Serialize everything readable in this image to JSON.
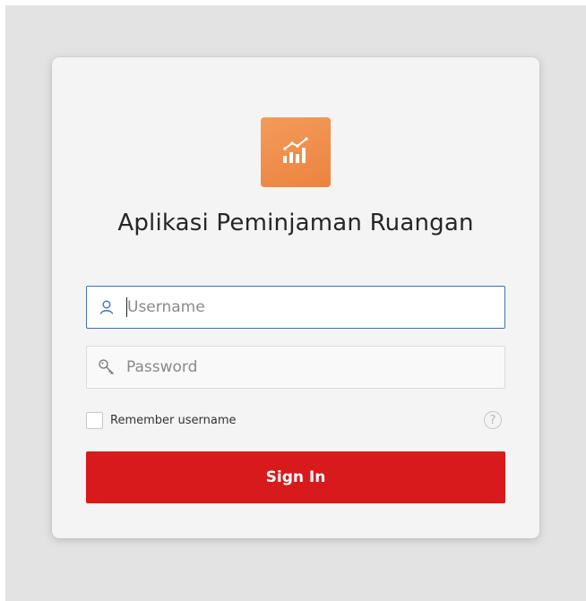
{
  "app": {
    "title": "Aplikasi Peminjaman Ruangan",
    "logo_icon": "chart-bars-icon"
  },
  "form": {
    "username": {
      "value": "",
      "placeholder": "Username",
      "icon": "user-icon"
    },
    "password": {
      "value": "",
      "placeholder": "Password",
      "icon": "key-icon"
    },
    "remember": {
      "label": "Remember username",
      "checked": false
    },
    "help_glyph": "?",
    "submit_label": "Sign In"
  },
  "colors": {
    "background": "#e3e3e3",
    "card": "#f4f4f4",
    "logo": "#ef8a48",
    "focus_border": "#3b73b9",
    "primary_button": "#d91a1d"
  }
}
